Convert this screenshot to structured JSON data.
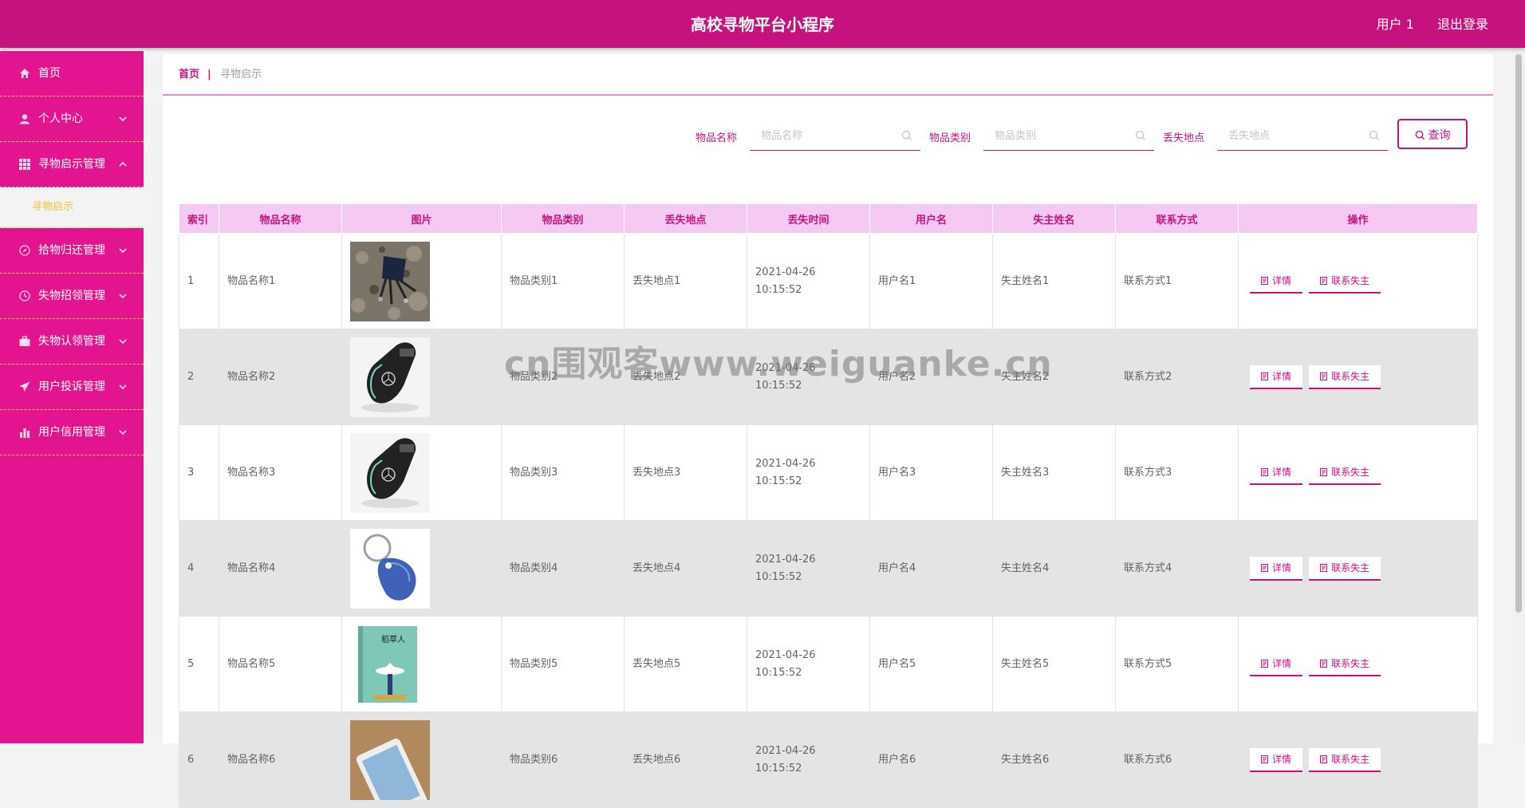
{
  "header": {
    "title": "高校寻物平台小程序",
    "user": "用户 1",
    "logout": "退出登录"
  },
  "sidebar": {
    "items": [
      {
        "label": "首页",
        "icon": "home-icon"
      },
      {
        "label": "个人中心",
        "icon": "user-icon"
      },
      {
        "label": "寻物启示管理",
        "icon": "grid-icon"
      },
      {
        "label": "拾物归还管理",
        "icon": "compass-icon"
      },
      {
        "label": "失物招领管理",
        "icon": "clock-icon"
      },
      {
        "label": "失物认领管理",
        "icon": "briefcase-icon"
      },
      {
        "label": "用户投诉管理",
        "icon": "send-icon"
      },
      {
        "label": "用户信用管理",
        "icon": "bar-chart-icon"
      }
    ],
    "submenu_item": "寻物启示"
  },
  "breadcrumb": {
    "home": "首页",
    "separator": "|",
    "current": "寻物启示"
  },
  "search": {
    "name_label": "物品名称",
    "name_placeholder": "物品名称",
    "category_label": "物品类别",
    "category_placeholder": "物品类别",
    "location_label": "丢失地点",
    "location_placeholder": "丢失地点",
    "query_button": "查询"
  },
  "table": {
    "headers": [
      "索引",
      "物品名称",
      "图片",
      "物品类别",
      "丢失地点",
      "丢失时间",
      "用户名",
      "失主姓名",
      "联系方式",
      "操作"
    ],
    "rows": [
      {
        "index": "1",
        "name": "物品名称1",
        "image": "wallet-keys",
        "category": "物品类别1",
        "location": "丢失地点1",
        "time": "2021-04-26 10:15:52",
        "username": "用户名1",
        "owner": "失主姓名1",
        "contact": "联系方式1"
      },
      {
        "index": "2",
        "name": "物品名称2",
        "image": "car-key",
        "category": "物品类别2",
        "location": "丢失地点2",
        "time": "2021-04-26 10:15:52",
        "username": "用户名2",
        "owner": "失主姓名2",
        "contact": "联系方式2"
      },
      {
        "index": "3",
        "name": "物品名称3",
        "image": "car-key",
        "category": "物品类别3",
        "location": "丢失地点3",
        "time": "2021-04-26 10:15:52",
        "username": "用户名3",
        "owner": "失主姓名3",
        "contact": "联系方式3"
      },
      {
        "index": "4",
        "name": "物品名称4",
        "image": "key-fob",
        "category": "物品类别4",
        "location": "丢失地点4",
        "time": "2021-04-26 10:15:52",
        "username": "用户名4",
        "owner": "失主姓名4",
        "contact": "联系方式4"
      },
      {
        "index": "5",
        "name": "物品名称5",
        "image": "book",
        "category": "物品类别5",
        "location": "丢失地点5",
        "time": "2021-04-26 10:15:52",
        "username": "用户名5",
        "owner": "失主姓名5",
        "contact": "联系方式5"
      },
      {
        "index": "6",
        "name": "物品名称6",
        "image": "phone",
        "category": "物品类别6",
        "location": "丢失地点6",
        "time": "2021-04-26 10:15:52",
        "username": "用户名6",
        "owner": "失主姓名6",
        "contact": "联系方式6"
      }
    ],
    "actions": {
      "detail": "详情",
      "contact_owner": "联系失主"
    }
  },
  "book_cover_title": "稻草人",
  "watermark": "cn围观客www.weiguanke.cn",
  "colors": {
    "primary": "#c6127e",
    "sidebar": "#e3148f",
    "header_bg_table": "#f6c9f3",
    "accent": "#f4d03f"
  }
}
